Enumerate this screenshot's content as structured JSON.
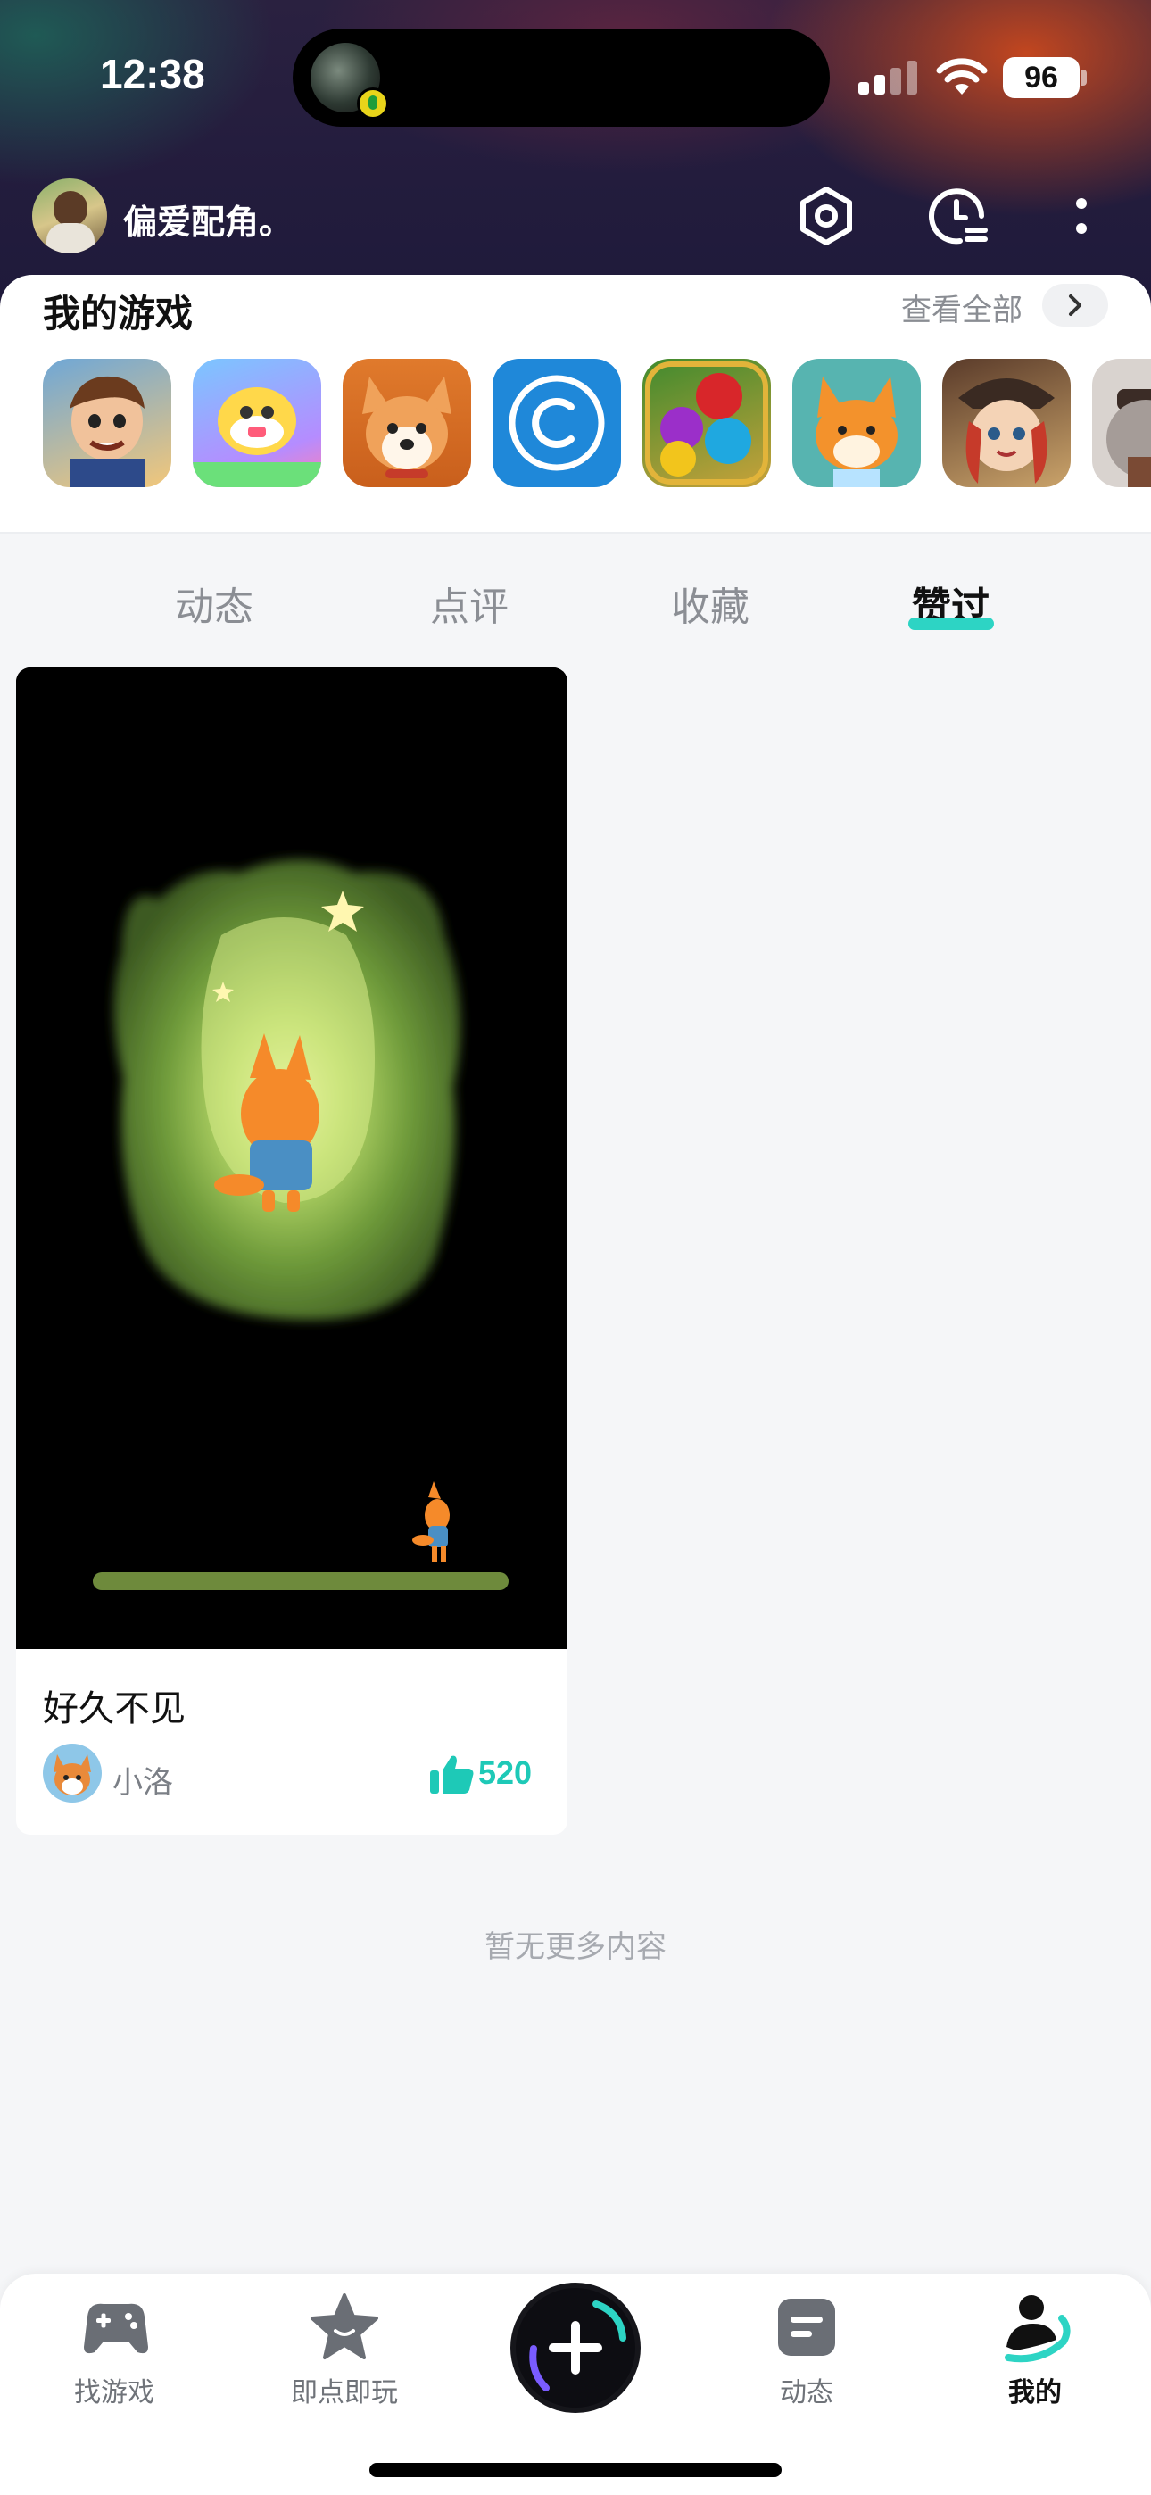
{
  "status_bar": {
    "time": "12:38",
    "battery": "96"
  },
  "header": {
    "username": "偏爱配角。"
  },
  "games": {
    "title": "我的游戏",
    "view_all": "查看全部",
    "apps": [
      {
        "icon": "jetpack-hero-app-icon"
      },
      {
        "icon": "cartoon-robot-app-icon"
      },
      {
        "icon": "corgi-dog-app-icon"
      },
      {
        "icon": "copyright-c-app-icon"
      },
      {
        "icon": "colorful-balls-app-icon"
      },
      {
        "icon": "orange-fox-app-icon"
      },
      {
        "icon": "pirate-girl-app-icon"
      },
      {
        "icon": "elephant-app-icon"
      }
    ]
  },
  "tabs": [
    "动态",
    "点评",
    "收藏",
    "赞过"
  ],
  "active_tab": "赞过",
  "card": {
    "title": "好久不见",
    "author": "小洛",
    "likes": "520"
  },
  "footer_text": "暂无更多内容",
  "bottom_nav": {
    "items": [
      "找游戏",
      "即点即玩",
      "动态",
      "我的"
    ],
    "active": "我的"
  },
  "colors": {
    "accent": "#1ec9b7",
    "tab_underline": "#2dd4c4"
  }
}
